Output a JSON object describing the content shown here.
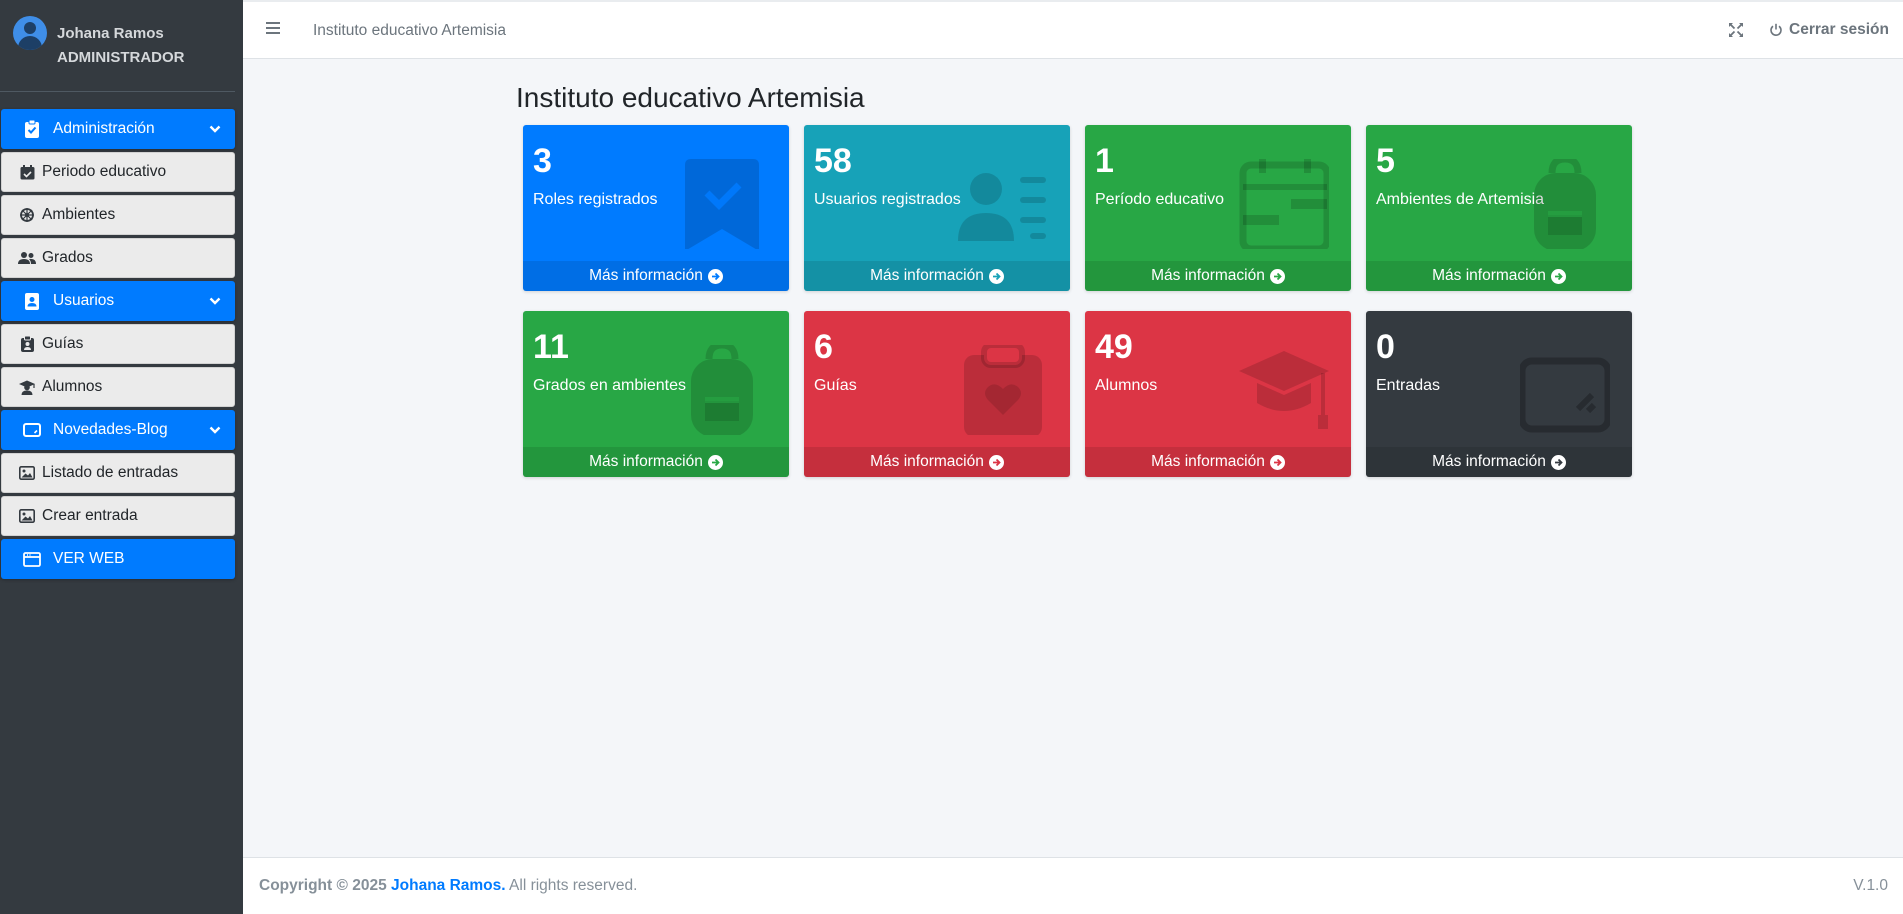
{
  "user": {
    "name": "Johana Ramos",
    "role": "ADMINISTRADOR"
  },
  "sidebar": {
    "items": [
      {
        "label": "Administración",
        "icon": "clipboard-check-icon",
        "type": "section"
      },
      {
        "label": "Periodo educativo",
        "icon": "calendar-check-icon",
        "type": "link"
      },
      {
        "label": "Ambientes",
        "icon": "dharmachakra-icon",
        "type": "link"
      },
      {
        "label": "Grados",
        "icon": "user-friends-icon",
        "type": "link"
      },
      {
        "label": "Usuarios",
        "icon": "address-book-icon",
        "type": "section"
      },
      {
        "label": "Guías",
        "icon": "clipboard-user-icon",
        "type": "link"
      },
      {
        "label": "Alumnos",
        "icon": "user-graduate-icon",
        "type": "link"
      },
      {
        "label": "Novedades-Blog",
        "icon": "tablet-icon",
        "type": "section"
      },
      {
        "label": "Listado de entradas",
        "icon": "image-icon",
        "type": "link"
      },
      {
        "label": "Crear entrada",
        "icon": "image-icon",
        "type": "link"
      },
      {
        "label": "VER WEB",
        "icon": "window-icon",
        "type": "button"
      }
    ]
  },
  "header": {
    "title": "Instituto educativo Artemisia",
    "logout_label": "Cerrar sesión"
  },
  "main": {
    "title": "Instituto educativo Artemisia",
    "more_info_label": "Más información",
    "boxes": [
      {
        "value": "3",
        "label": "Roles registrados",
        "icon": "bookmark-check-icon",
        "color": "#007bff"
      },
      {
        "value": "58",
        "label": "Usuarios registrados",
        "icon": "user-list-icon",
        "color": "#17a2b8"
      },
      {
        "value": "1",
        "label": "Período educativo",
        "icon": "calendar-icon",
        "color": "#28a745"
      },
      {
        "value": "5",
        "label": "Ambientes de Artemisia",
        "icon": "backpack-icon",
        "color": "#28a745"
      },
      {
        "value": "11",
        "label": "Grados en ambientes",
        "icon": "backpack-icon",
        "color": "#28a745"
      },
      {
        "value": "6",
        "label": "Guías",
        "icon": "clipboard-heart-icon",
        "color": "#dc3545"
      },
      {
        "value": "49",
        "label": "Alumnos",
        "icon": "graduation-cap-icon",
        "color": "#dc3545"
      },
      {
        "value": "0",
        "label": "Entradas",
        "icon": "tablet-icon",
        "color": "#343a40"
      }
    ]
  },
  "footer": {
    "copyright": "Copyright © 2025",
    "brand": "Johana Ramos.",
    "rights": "All rights reserved.",
    "version": "V.1.0"
  }
}
